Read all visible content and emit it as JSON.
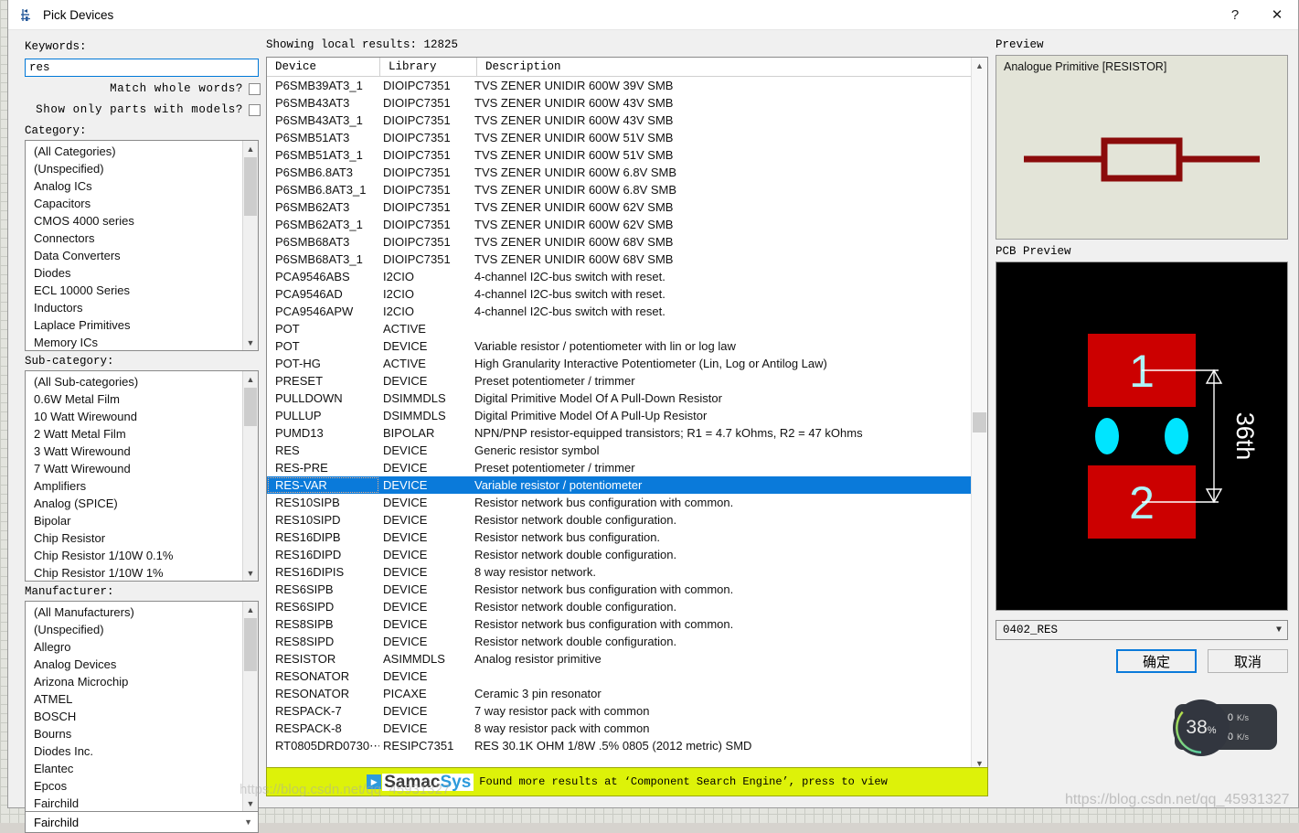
{
  "window": {
    "title": "Pick Devices",
    "icon": "component-icon",
    "help_button": "?",
    "close_button": "✕"
  },
  "search": {
    "keywords_label": "Keywords:",
    "keywords_value": "res",
    "match_whole_words_label": "Match whole words?",
    "match_whole_words_checked": false,
    "show_only_with_models_label": "Show only parts with models?",
    "show_only_with_models_checked": false
  },
  "category": {
    "label": "Category:",
    "items": [
      "(All Categories)",
      "(Unspecified)",
      "Analog ICs",
      "Capacitors",
      "CMOS 4000 series",
      "Connectors",
      "Data Converters",
      "Diodes",
      "ECL 10000 Series",
      "Inductors",
      "Laplace Primitives",
      "Memory ICs"
    ]
  },
  "subcategory": {
    "label": "Sub-category:",
    "items": [
      "(All Sub-categories)",
      "0.6W Metal Film",
      "10 Watt Wirewound",
      "2 Watt Metal Film",
      "3 Watt Wirewound",
      "7 Watt Wirewound",
      "Amplifiers",
      "Analog (SPICE)",
      "Bipolar",
      "Chip Resistor",
      "Chip Resistor 1/10W 0.1%",
      "Chip Resistor 1/10W 1%"
    ]
  },
  "manufacturer": {
    "label": "Manufacturer:",
    "items": [
      "(All Manufacturers)",
      "(Unspecified)",
      "Allegro",
      "Analog Devices",
      "Arizona Microchip",
      "ATMEL",
      "BOSCH",
      "Bourns",
      "Diodes Inc.",
      "Elantec",
      "Epcos",
      "Fairchild"
    ],
    "last_visible": "Fairchild"
  },
  "results": {
    "showing_text": "Showing local results: 12825",
    "columns": [
      "Device",
      "Library",
      "Description"
    ],
    "selected_index": 23,
    "rows": [
      [
        "P6SMB39AT3_1",
        "DIOIPC7351",
        "TVS ZENER UNIDIR 600W 39V SMB"
      ],
      [
        "P6SMB43AT3",
        "DIOIPC7351",
        "TVS ZENER UNIDIR 600W 43V SMB"
      ],
      [
        "P6SMB43AT3_1",
        "DIOIPC7351",
        "TVS ZENER UNIDIR 600W 43V SMB"
      ],
      [
        "P6SMB51AT3",
        "DIOIPC7351",
        "TVS ZENER UNIDIR 600W 51V SMB"
      ],
      [
        "P6SMB51AT3_1",
        "DIOIPC7351",
        "TVS ZENER UNIDIR 600W 51V SMB"
      ],
      [
        "P6SMB6.8AT3",
        "DIOIPC7351",
        "TVS ZENER UNIDIR 600W 6.8V SMB"
      ],
      [
        "P6SMB6.8AT3_1",
        "DIOIPC7351",
        "TVS ZENER UNIDIR 600W 6.8V SMB"
      ],
      [
        "P6SMB62AT3",
        "DIOIPC7351",
        "TVS ZENER UNIDIR 600W 62V SMB"
      ],
      [
        "P6SMB62AT3_1",
        "DIOIPC7351",
        "TVS ZENER UNIDIR 600W 62V SMB"
      ],
      [
        "P6SMB68AT3",
        "DIOIPC7351",
        "TVS ZENER UNIDIR 600W 68V SMB"
      ],
      [
        "P6SMB68AT3_1",
        "DIOIPC7351",
        "TVS ZENER UNIDIR 600W 68V SMB"
      ],
      [
        "PCA9546ABS",
        "I2CIO",
        "4-channel I2C-bus switch with reset."
      ],
      [
        "PCA9546AD",
        "I2CIO",
        "4-channel I2C-bus switch with reset."
      ],
      [
        "PCA9546APW",
        "I2CIO",
        "4-channel I2C-bus switch with reset."
      ],
      [
        "POT",
        "ACTIVE",
        ""
      ],
      [
        "POT",
        "DEVICE",
        "Variable resistor / potentiometer with lin or log law"
      ],
      [
        "POT-HG",
        "ACTIVE",
        "High Granularity Interactive Potentiometer (Lin, Log or Antilog Law)"
      ],
      [
        "PRESET",
        "DEVICE",
        "Preset potentiometer / trimmer"
      ],
      [
        "PULLDOWN",
        "DSIMMDLS",
        "Digital Primitive Model Of A Pull-Down Resistor"
      ],
      [
        "PULLUP",
        "DSIMMDLS",
        "Digital Primitive Model Of A Pull-Up Resistor"
      ],
      [
        "PUMD13",
        "BIPOLAR",
        "NPN/PNP resistor-equipped transistors; R1 = 4.7 kOhms, R2 = 47 kOhms"
      ],
      [
        "RES",
        "DEVICE",
        "Generic resistor symbol"
      ],
      [
        "RES-PRE",
        "DEVICE",
        "Preset potentiometer / trimmer"
      ],
      [
        "RES-VAR",
        "DEVICE",
        "Variable resistor / potentiometer"
      ],
      [
        "RES10SIPB",
        "DEVICE",
        "Resistor network bus configuration with common."
      ],
      [
        "RES10SIPD",
        "DEVICE",
        "Resistor network double configuration."
      ],
      [
        "RES16DIPB",
        "DEVICE",
        "Resistor network bus configuration."
      ],
      [
        "RES16DIPD",
        "DEVICE",
        "Resistor network double configuration."
      ],
      [
        "RES16DIPIS",
        "DEVICE",
        "8 way resistor network."
      ],
      [
        "RES6SIPB",
        "DEVICE",
        "Resistor network bus configuration with common."
      ],
      [
        "RES6SIPD",
        "DEVICE",
        "Resistor network double configuration."
      ],
      [
        "RES8SIPB",
        "DEVICE",
        "Resistor network bus configuration with common."
      ],
      [
        "RES8SIPD",
        "DEVICE",
        "Resistor network double configuration."
      ],
      [
        "RESISTOR",
        "ASIMMDLS",
        "Analog resistor primitive"
      ],
      [
        "RESONATOR",
        "DEVICE",
        ""
      ],
      [
        "RESONATOR",
        "PICAXE",
        "Ceramic 3 pin resonator"
      ],
      [
        "RESPACK-7",
        "DEVICE",
        "7 way resistor pack with common"
      ],
      [
        "RESPACK-8",
        "DEVICE",
        "8 way resistor pack with common"
      ],
      [
        "RT0805DRD0730⋯",
        "RESIPC7351",
        "RES 30.1K OHM 1/8W .5% 0805 (2012 metric) SMD"
      ]
    ]
  },
  "selected_row_name": "RES",
  "banner": {
    "logo_play": "▶",
    "logo_part1": "Samac",
    "logo_part2": "Sys",
    "message": "Found more results at ‘Component Search Engine’, press to view",
    "bg_color": "#ddf209"
  },
  "preview": {
    "label": "Preview",
    "caption": "Analogue Primitive [RESISTOR]",
    "symbol_color": "#8b0b0b",
    "bg_color": "#e3e4d8"
  },
  "pcb_preview": {
    "label": "PCB Preview",
    "pad1_label": "1",
    "pad2_label": "2",
    "dimension_label": "36th",
    "pad_color": "#cc0000",
    "hole_color": "#00e5ff",
    "bg_color": "#000000"
  },
  "package": {
    "value": "0402_RES",
    "dropdown_icon": "chevron-down-icon"
  },
  "buttons": {
    "ok": "确定",
    "cancel": "取消"
  },
  "net_widget": {
    "percent": "38",
    "percent_unit": "%",
    "upload": "0",
    "upload_unit": "K/s",
    "download": "0",
    "download_unit": "K/s",
    "up_icon": "arrow-up-icon",
    "down_icon": "arrow-down-icon"
  },
  "watermark": {
    "text": "https://blog.csdn.net/qq_45931327",
    "text2": "https://blog.csdn.net/qq_45931327"
  }
}
